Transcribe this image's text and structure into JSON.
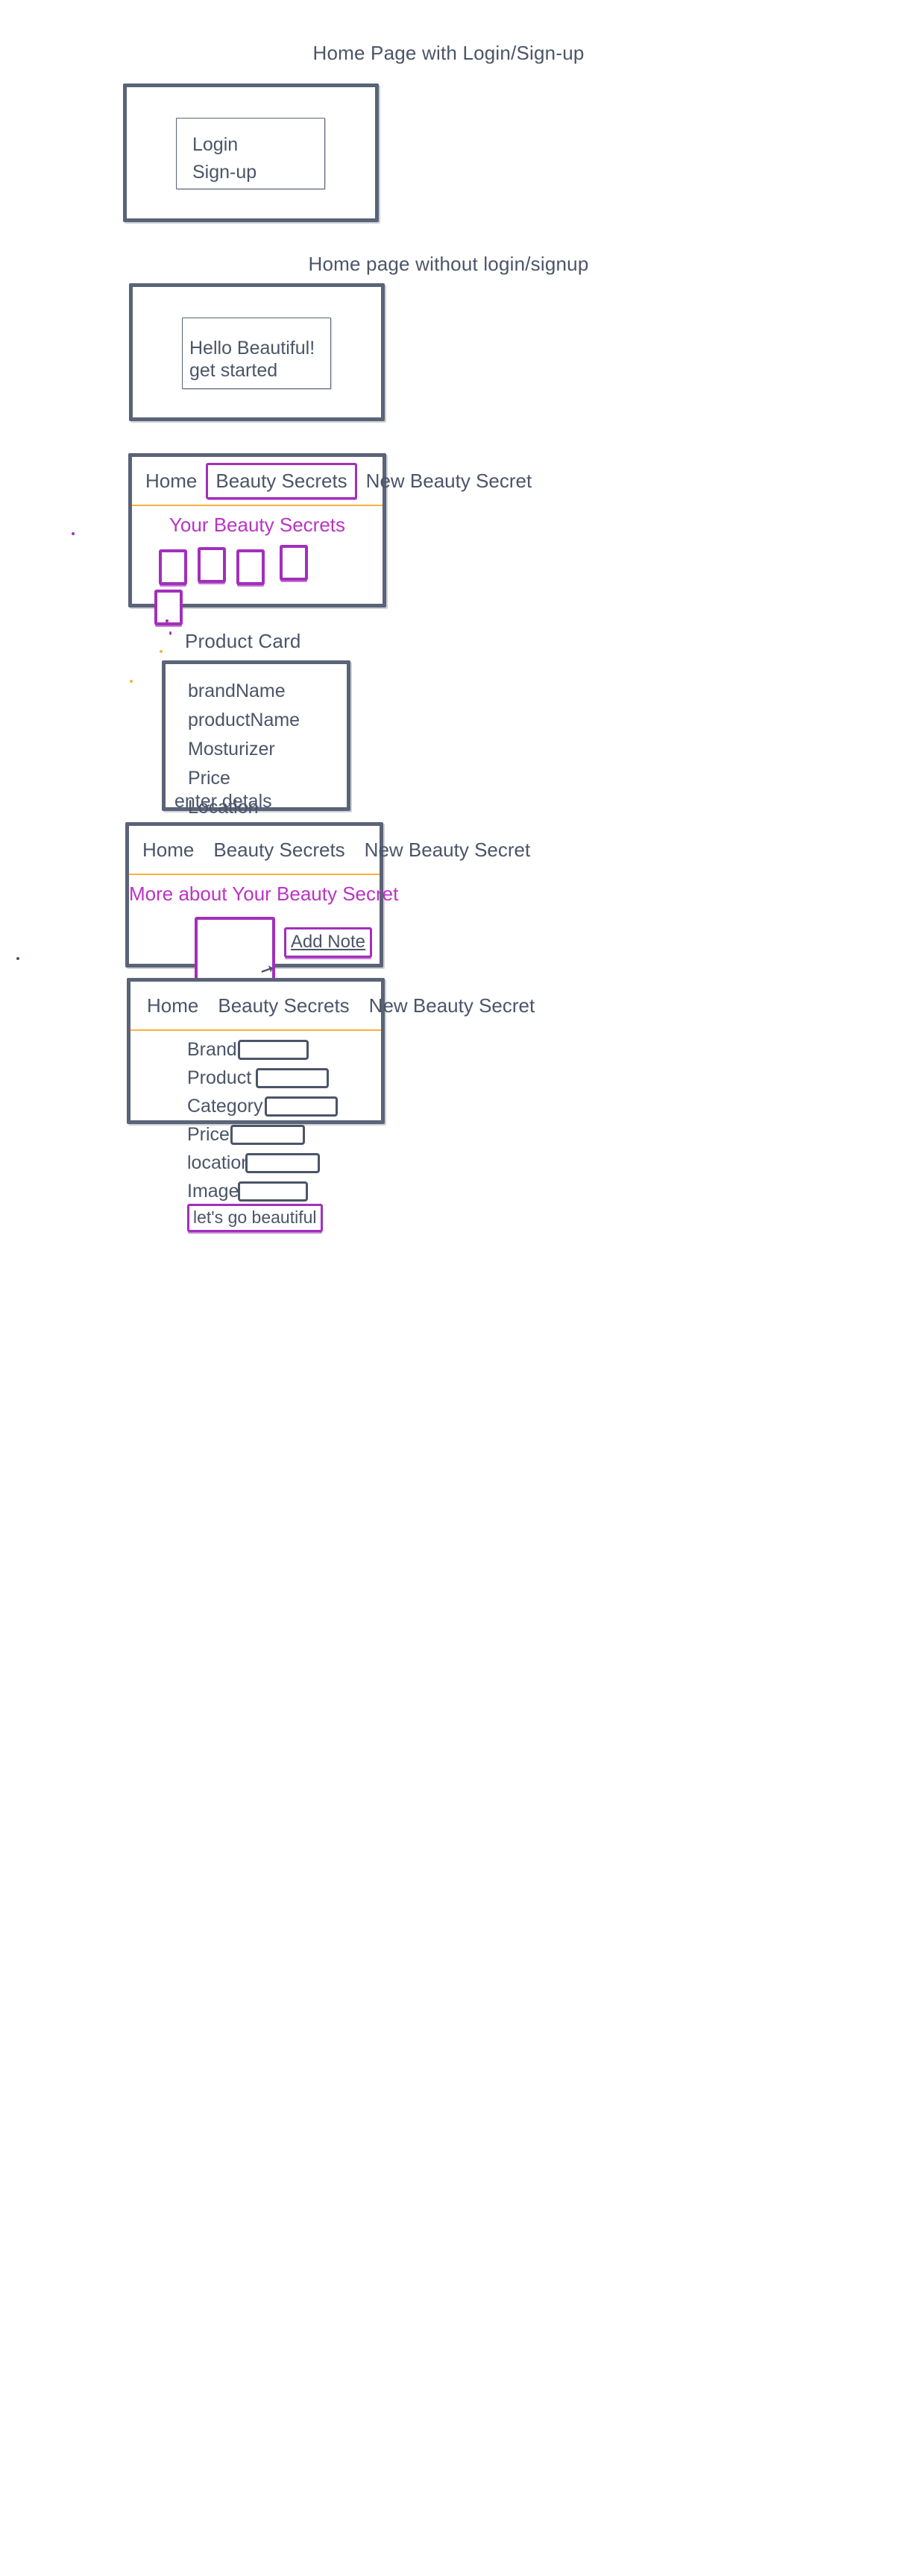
{
  "colors": {
    "frame_stroke": "#5a6377",
    "text": "#4b5568",
    "accent_purple": "#a22fbb",
    "heading_pink": "#bb33c4",
    "nav_underline_orange": "#fbb040",
    "background": "#ffffff"
  },
  "sections": {
    "home_with_auth": {
      "title": "Home Page with Login/Sign-up",
      "panel": {
        "login_label": "Login",
        "signup_label": "Sign-up"
      }
    },
    "home_without_auth": {
      "title": "Home page without login/signup",
      "panel": {
        "greeting": "Hello Beautiful!",
        "cta": "get started"
      }
    },
    "beauty_secrets_list": {
      "nav": {
        "items": [
          {
            "label": "Home",
            "selected": false
          },
          {
            "label": "Beauty Secrets",
            "selected": true
          },
          {
            "label": "New Beauty Secret",
            "selected": false
          }
        ]
      },
      "heading": "Your Beauty Secrets",
      "card_count": 5
    },
    "product_card": {
      "title": "Product Card",
      "fields": [
        "brandName",
        "productName",
        "Mosturizer",
        "Price",
        "Location"
      ],
      "footer_action": "enter detals"
    },
    "secret_detail": {
      "nav": {
        "items": [
          {
            "label": "Home",
            "selected": false
          },
          {
            "label": "Beauty Secrets",
            "selected": false
          },
          {
            "label": "New Beauty Secret",
            "selected": false
          }
        ]
      },
      "heading": "More about Your Beauty Secret",
      "note_button": "Add Note"
    },
    "new_secret_form": {
      "nav": {
        "items": [
          {
            "label": "Home",
            "selected": false
          },
          {
            "label": "Beauty Secrets",
            "selected": false
          },
          {
            "label": "New Beauty Secret",
            "selected": false
          }
        ]
      },
      "fields": [
        {
          "label": "Brand",
          "value": "",
          "input_width": 136,
          "label_width": 98
        },
        {
          "label": "Product",
          "value": "",
          "input_width": 136,
          "label_width": 126
        },
        {
          "label": "Category",
          "value": "",
          "input_width": 136,
          "label_width": 142
        },
        {
          "label": "Price",
          "value": "",
          "input_width": 136,
          "label_width": 80
        },
        {
          "label": "location",
          "value": "",
          "input_width": 136,
          "label_width": 116
        },
        {
          "label": "Image",
          "value": "",
          "input_width": 136,
          "label_width": 90
        }
      ],
      "submit_label": "let's go beautiful"
    }
  }
}
